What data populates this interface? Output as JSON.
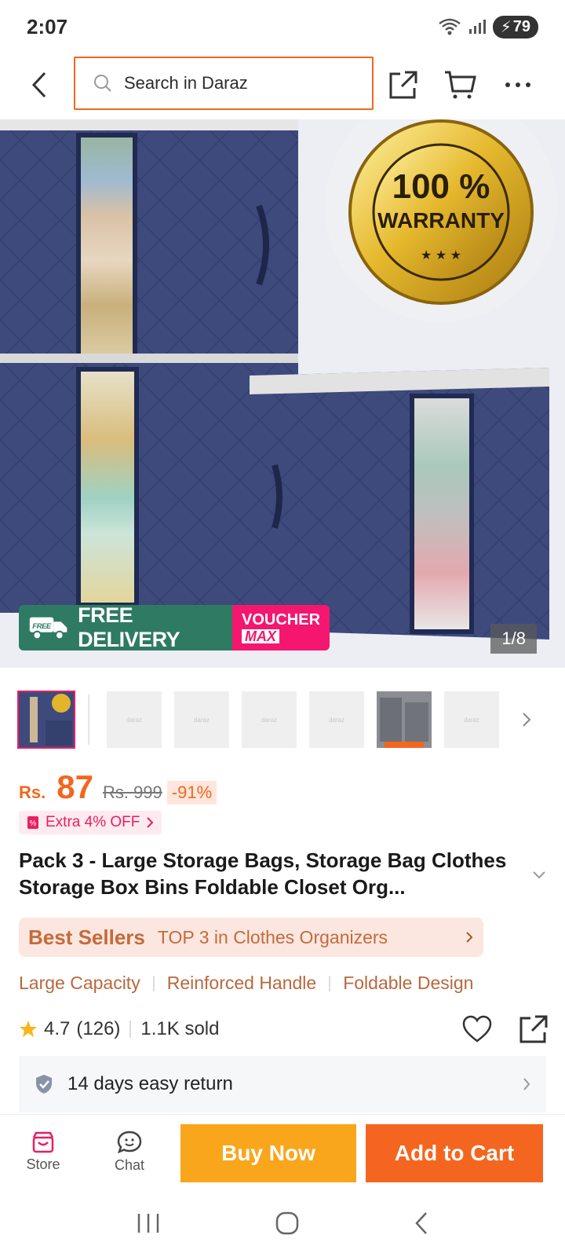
{
  "status": {
    "time": "2:07",
    "battery": "79"
  },
  "header": {
    "search_placeholder": "Search in Daraz"
  },
  "hero": {
    "free_delivery": "FREE DELIVERY",
    "free_tag": "FREE",
    "voucher_line1": "VOUCHER",
    "voucher_line2": "MAX",
    "seal_line1": "100 %",
    "seal_line2": "WARRANTY",
    "page_indicator": "1/8"
  },
  "thumbnails": {
    "count": 7,
    "placeholder": "daraz"
  },
  "price": {
    "currency": "Rs.",
    "current": "87",
    "original": "Rs. 999",
    "discount": "-91%",
    "extra_offer": "Extra 4% OFF"
  },
  "product": {
    "title": "Pack 3 - Large Storage Bags, Storage Bag Clothes Storage Box Bins Foldable Closet Org..."
  },
  "best_sellers": {
    "brand": "Best Sellers",
    "text": "TOP 3 in Clothes Organizers"
  },
  "features": [
    "Large Capacity",
    "Reinforced Handle",
    "Foldable Design"
  ],
  "rating": {
    "score": "4.7",
    "count": "(126)",
    "sold": "1.1K sold"
  },
  "return_policy": "14 days easy return",
  "bottom_bar": {
    "store": "Store",
    "chat": "Chat",
    "buy_now": "Buy Now",
    "add_to_cart": "Add to Cart"
  },
  "colors": {
    "accent": "#f4661f",
    "buy_now": "#f9a61c",
    "pink": "#e91e63",
    "delivery_green": "#2f7a63"
  }
}
